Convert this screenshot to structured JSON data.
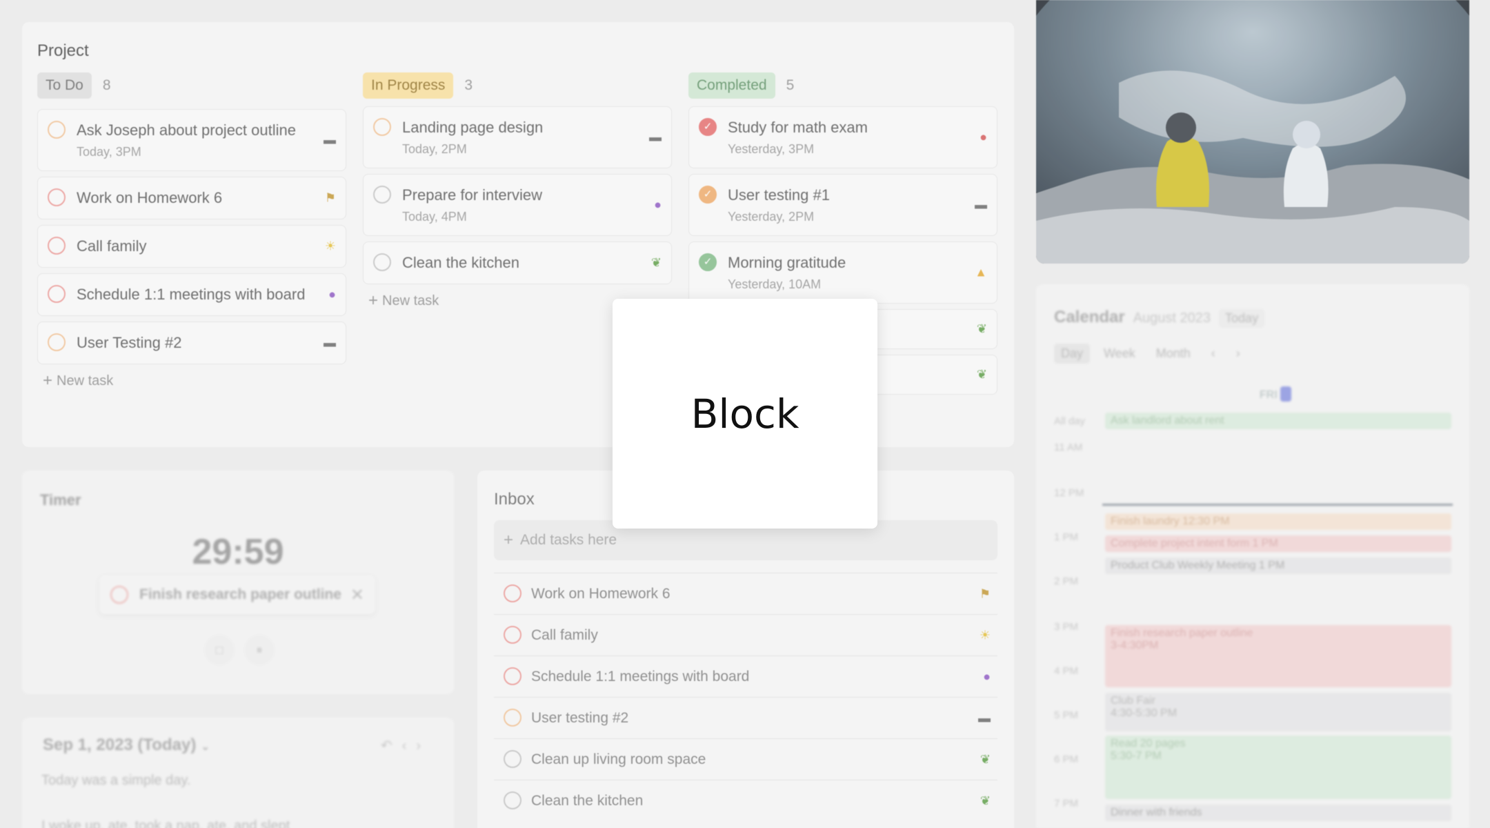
{
  "project": {
    "title": "Project",
    "columns": [
      {
        "label": "To Do",
        "count": "8",
        "cards": [
          {
            "title": "Ask Joseph about project outline",
            "sub": "Today, 3PM",
            "icon": "laptop-icon"
          },
          {
            "title": "Work on Homework 6",
            "sub": "",
            "icon": "flag-icon"
          },
          {
            "title": "Call family",
            "sub": "",
            "icon": "sun-icon"
          },
          {
            "title": "Schedule 1:1 meetings with board",
            "sub": "",
            "icon": "crystal-ball-icon"
          },
          {
            "title": "User Testing #2",
            "sub": "",
            "icon": "laptop-icon"
          }
        ],
        "new_task": "New task"
      },
      {
        "label": "In Progress",
        "count": "3",
        "cards": [
          {
            "title": "Landing page design",
            "sub": "Today, 2PM",
            "icon": "laptop-icon"
          },
          {
            "title": "Prepare for interview",
            "sub": "Today, 4PM",
            "icon": "crystal-ball-icon"
          },
          {
            "title": "Clean the kitchen",
            "sub": "",
            "icon": "plant-icon"
          }
        ],
        "new_task": "New task"
      },
      {
        "label": "Completed",
        "count": "5",
        "cards": [
          {
            "title": "Study for math exam",
            "sub": "Yesterday, 3PM",
            "icon": "bell-icon"
          },
          {
            "title": "User testing #1",
            "sub": "Yesterday, 2PM",
            "icon": "laptop-icon"
          },
          {
            "title": "Morning gratitude",
            "sub": "Yesterday, 10AM",
            "icon": "pray-icon"
          },
          {
            "title": "",
            "sub": "",
            "icon": "plant-icon"
          },
          {
            "title": "",
            "sub": "",
            "icon": "plant-icon"
          }
        ]
      }
    ]
  },
  "timer": {
    "label": "Timer",
    "time": "29:59",
    "task": "Finish research paper outline"
  },
  "journal": {
    "date": "Sep 1, 2023 (Today)",
    "lines": [
      "Today was a simple day.",
      "I woke up, ate, took a nap, ate, and slept"
    ]
  },
  "inbox": {
    "label": "Inbox",
    "add_placeholder": "Add tasks here",
    "items": [
      {
        "title": "Work on Homework 6",
        "icon": "flag-icon"
      },
      {
        "title": "Call family",
        "icon": "sun-icon"
      },
      {
        "title": "Schedule 1:1 meetings with board",
        "icon": "crystal-ball-icon"
      },
      {
        "title": "User testing #2",
        "icon": "laptop-icon"
      },
      {
        "title": "Clean up living room space",
        "icon": "plant-icon"
      },
      {
        "title": "Clean the kitchen",
        "icon": "plant-icon"
      }
    ]
  },
  "calendar": {
    "title": "Calendar",
    "month": "August 2023",
    "today_button": "Today",
    "views": [
      "Day",
      "Week",
      "Month"
    ],
    "day_label": "FRI",
    "all_day_label": "All day",
    "hours": [
      "11 AM",
      "12 PM",
      "1 PM",
      "2 PM",
      "3 PM",
      "4 PM",
      "5 PM",
      "6 PM",
      "7 PM"
    ],
    "events": [
      {
        "title": "Ask landlord about rent",
        "time": "",
        "color": "#d8ecdb"
      },
      {
        "title": "Finish laundry",
        "time": "12:30 PM",
        "color": "#f7e2cf"
      },
      {
        "title": "Complete project intent form",
        "time": "1 PM",
        "color": "#f4d2d2"
      },
      {
        "title": "Product Club Weekly Meeting",
        "time": "1 PM",
        "color": "#e6e6e8"
      },
      {
        "title": "Finish research paper outline",
        "time": "3-4:30PM",
        "color": "#f4d2d2"
      },
      {
        "title": "Club Fair",
        "time": "4:30-5:30 PM",
        "color": "#e6e6e8"
      },
      {
        "title": "Read 20 pages",
        "time": "5:30-7 PM",
        "color": "#d8ecdb"
      },
      {
        "title": "Dinner with friends",
        "time": "",
        "color": "#e6e6e8"
      }
    ]
  },
  "block": {
    "label": "Block"
  }
}
